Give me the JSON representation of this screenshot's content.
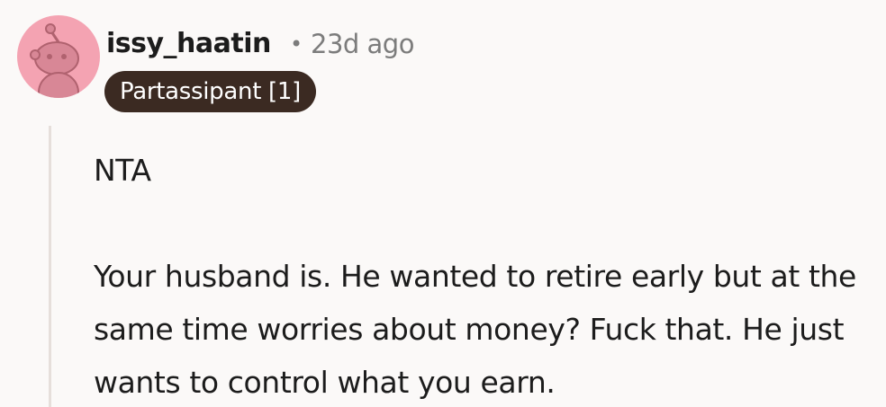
{
  "comment": {
    "author": "issy_haatin",
    "separator": "•",
    "timestamp": "23d ago",
    "flair": "Partassipant [1]",
    "paragraphs": [
      "NTA",
      "Your husband is. He wanted to retire early but at the same time worries about money? Fuck that. He just wants to control what you earn."
    ]
  },
  "colors": {
    "avatar_bg": "#f4a3b2",
    "flair_bg": "#3b2a22",
    "page_bg": "#fbf9f8",
    "thread_line": "#e6dfdb"
  }
}
